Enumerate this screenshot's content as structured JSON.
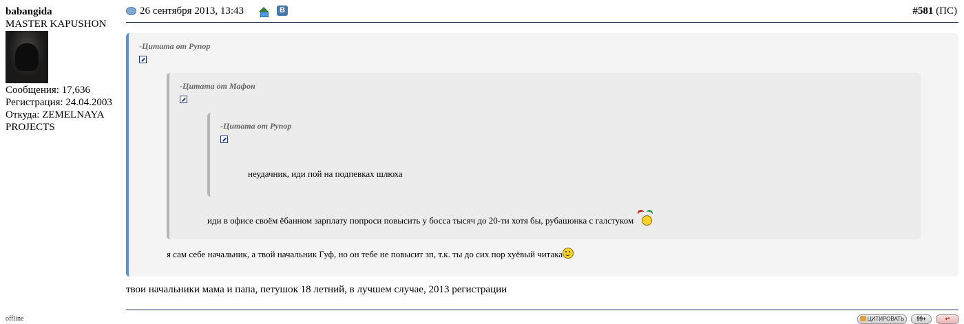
{
  "user": {
    "name": "babangida",
    "title": "MASTER KAPUSHON",
    "posts": "Сообщения: 17,636",
    "registered": "Регистрация: 24.04.2003",
    "location_line1": "Откуда: ZEMELNAYA",
    "location_line2": "PROJECTS",
    "status": "offline"
  },
  "post": {
    "date": "26 сентября 2013, 13:43",
    "number": "#581",
    "suffix": " (ПС)",
    "vk_label": "В"
  },
  "quotes": {
    "outer": {
      "author": "-Цитата от Рупор",
      "text": "я сам себе начальник, а твой начальник Гуф, но он тебе не повысит зп, т.к. ты до сих пор хуёвый читака"
    },
    "middle": {
      "author": "-Цитата от Мафон",
      "text": "иди в офисе своём ёбанном зарплату попроси повысить у босса тысяч до 20-ти хотя бы, рубашонка с галстуком"
    },
    "inner": {
      "author": "-Цитата от Рупор",
      "text": "неудачник, иди пой на подпевках шлюха"
    }
  },
  "message": "твои начальники мама и папа, петушок 18 летний, в лучшем случае, 2013 регистрации",
  "buttons": {
    "quote": "ЦИТИРОВАТЬ",
    "multi": "99+",
    "reply": "↩"
  }
}
